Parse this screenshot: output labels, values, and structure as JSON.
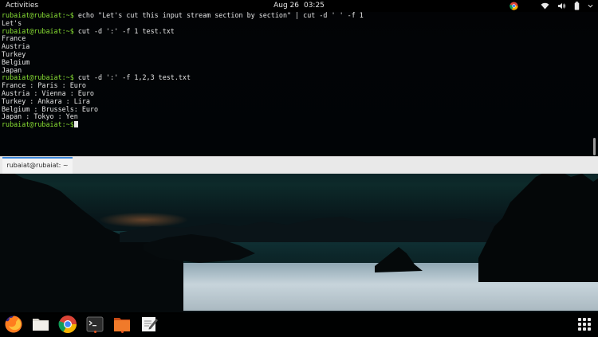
{
  "topbar": {
    "activities": "Activities",
    "date": "Aug 26",
    "time": "03:25"
  },
  "terminal": {
    "lines": [
      {
        "prompt": "rubaiat@rubaiat",
        "path": ":~$",
        "text": " echo \"Let's cut this input stream section by section\" | cut -d ' ' -f 1"
      },
      {
        "prompt": "",
        "path": "",
        "text": "Let's"
      },
      {
        "prompt": "rubaiat@rubaiat",
        "path": ":~$",
        "text": " cut -d ':' -f 1 test.txt"
      },
      {
        "prompt": "",
        "path": "",
        "text": "France"
      },
      {
        "prompt": "",
        "path": "",
        "text": "Austria"
      },
      {
        "prompt": "",
        "path": "",
        "text": "Turkey"
      },
      {
        "prompt": "",
        "path": "",
        "text": "Belgium"
      },
      {
        "prompt": "",
        "path": "",
        "text": "Japan"
      },
      {
        "prompt": "rubaiat@rubaiat",
        "path": ":~$",
        "text": " cut -d ':' -f 1,2,3 test.txt"
      },
      {
        "prompt": "",
        "path": "",
        "text": "France : Paris : Euro"
      },
      {
        "prompt": "",
        "path": "",
        "text": "Austria : Vienna : Euro"
      },
      {
        "prompt": "",
        "path": "",
        "text": "Turkey : Ankara : Lira"
      },
      {
        "prompt": "",
        "path": "",
        "text": "Belgium : Brussels: Euro"
      },
      {
        "prompt": "",
        "path": "",
        "text": "Japan : Tokyo : Yen"
      },
      {
        "prompt": "rubaiat@rubaiat",
        "path": ":~$",
        "text": ""
      }
    ],
    "tab_title": "rubaiat@rubaiat: ~"
  },
  "dock": {
    "items": [
      {
        "name": "firefox-icon"
      },
      {
        "name": "files-icon"
      },
      {
        "name": "chrome-icon"
      },
      {
        "name": "terminal-icon"
      },
      {
        "name": "files-orange-icon"
      },
      {
        "name": "text-editor-icon"
      },
      {
        "name": "show-applications-icon"
      }
    ]
  },
  "colors": {
    "prompt": "#8ae234",
    "accent": "#e95420",
    "tab_accent": "#3a86d9"
  }
}
